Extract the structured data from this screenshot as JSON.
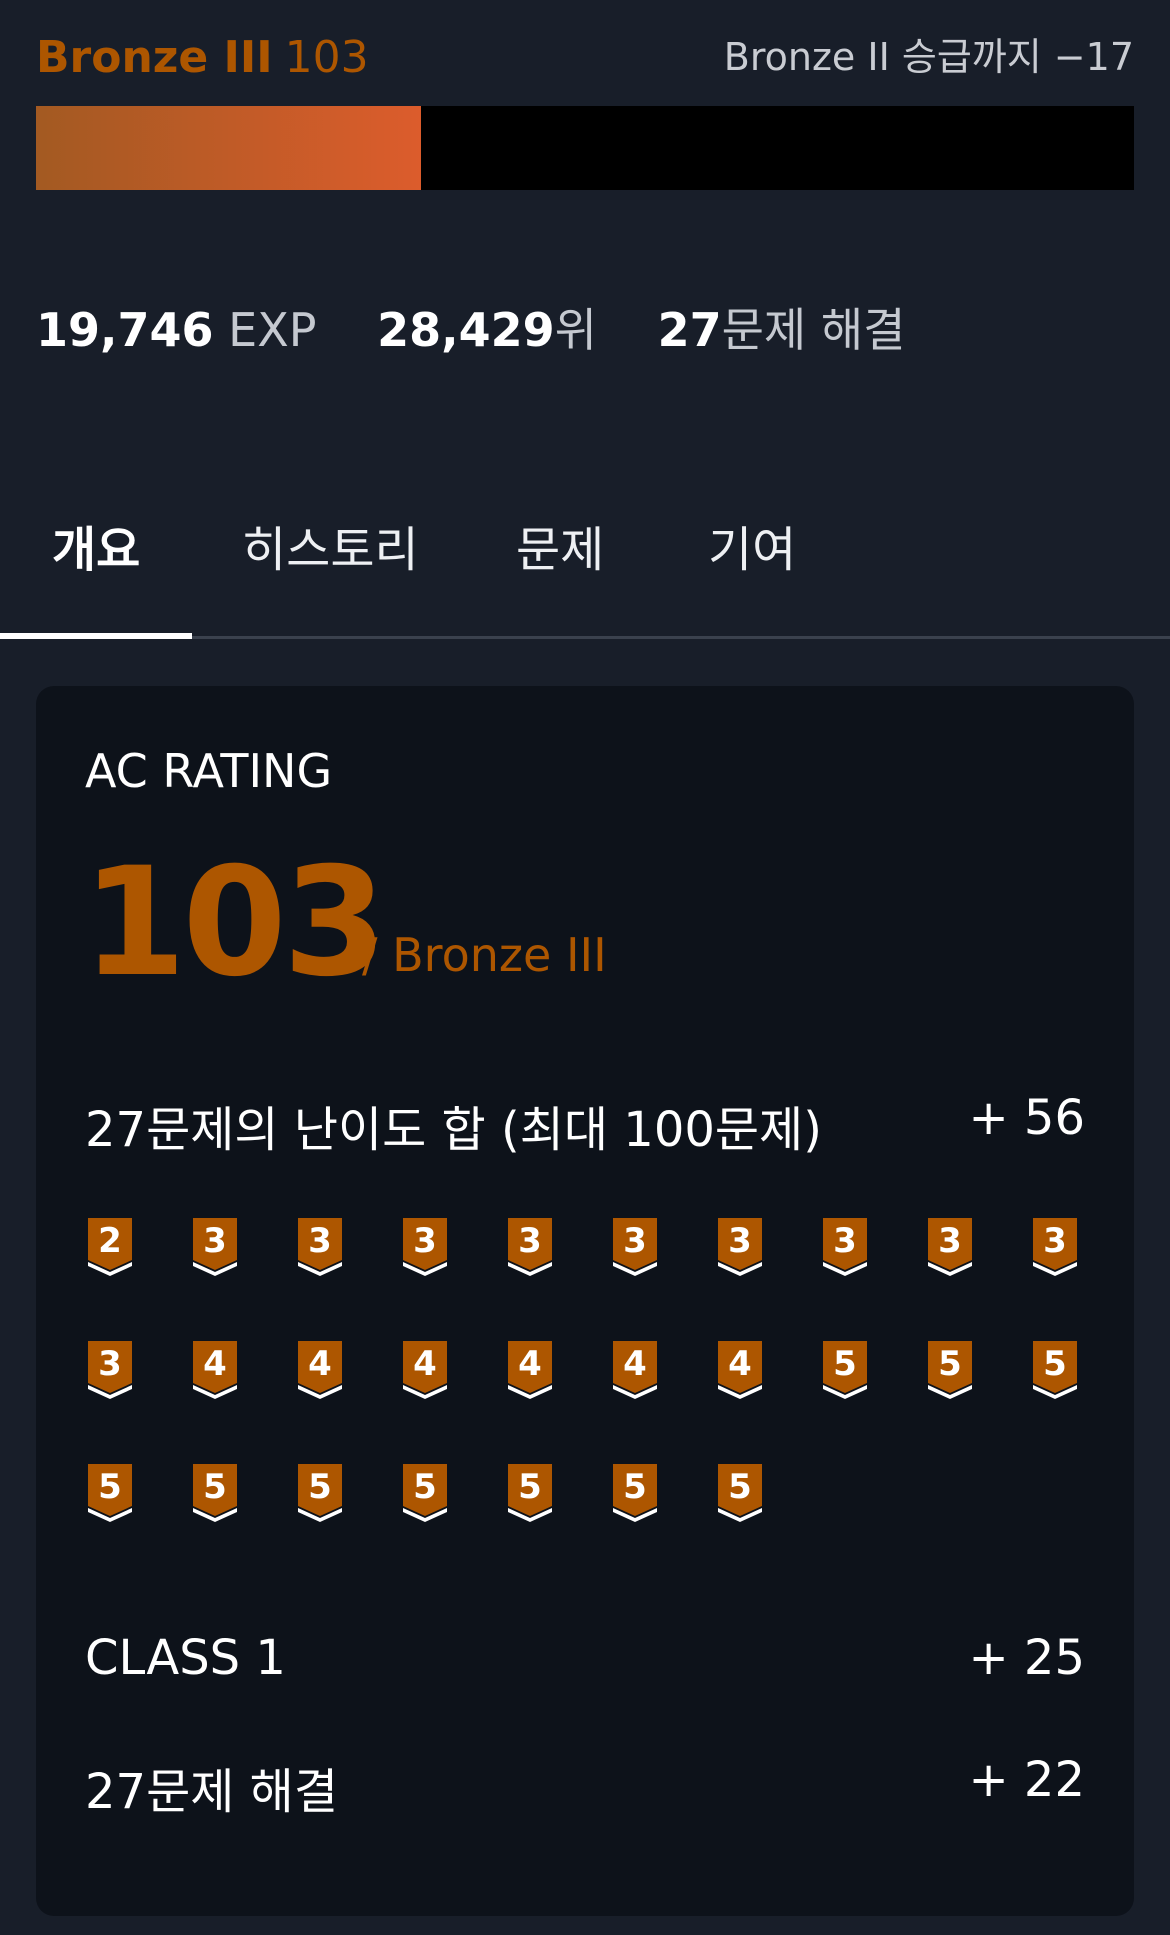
{
  "header": {
    "tier_name": "Bronze III",
    "tier_rating": "103",
    "promotion_text": "Bronze II 승급까지 −17",
    "progress_fraction": 0.351,
    "progress_colors": [
      "#a35a22",
      "#dc5c2c"
    ]
  },
  "stats": {
    "exp_value": "19,746",
    "exp_unit": "EXP",
    "rank_value": "28,429",
    "rank_unit": "위",
    "solved_value": "27",
    "solved_unit": "문제 해결"
  },
  "tabs": [
    {
      "label": "개요",
      "active": true
    },
    {
      "label": "히스토리",
      "active": false
    },
    {
      "label": "문제",
      "active": false
    },
    {
      "label": "기여",
      "active": false
    }
  ],
  "card": {
    "title": "AC RATING",
    "rating": "103",
    "rating_tier": "/ Bronze III",
    "difficulty_sum_label": "27문제의 난이도 합 (최대 100문제)",
    "difficulty_sum_value": "+ 56",
    "class_label": "CLASS 1",
    "class_value": "+ 25",
    "solved_label": "27문제 해결",
    "solved_value": "+ 22",
    "accent_color": "#ad5600"
  },
  "problem_badges": [
    "2",
    "3",
    "3",
    "3",
    "3",
    "3",
    "3",
    "3",
    "3",
    "3",
    "3",
    "4",
    "4",
    "4",
    "4",
    "4",
    "4",
    "5",
    "5",
    "5",
    "5",
    "5",
    "5",
    "5",
    "5",
    "5",
    "5"
  ]
}
